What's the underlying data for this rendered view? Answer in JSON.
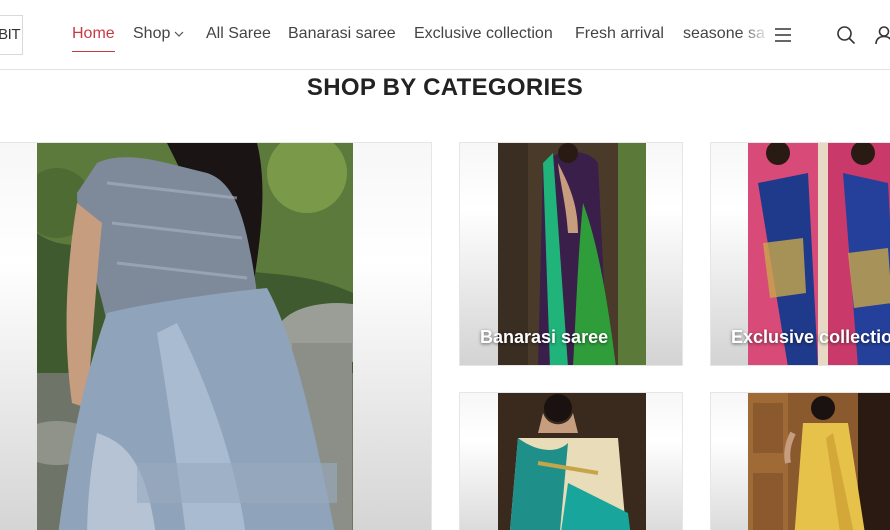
{
  "brand": {
    "logo_text": "EBIT"
  },
  "nav": {
    "items": [
      {
        "label": "Home",
        "active": true
      },
      {
        "label": "Shop",
        "has_dropdown": true
      },
      {
        "label": "All Saree"
      },
      {
        "label": "Banarasi saree"
      },
      {
        "label": "Exclusive collection"
      },
      {
        "label": "Fresh arrival"
      },
      {
        "label": "seasone sa"
      }
    ],
    "accent_color": "#c73a45"
  },
  "header_icons": [
    "menu-icon",
    "search-icon",
    "user-icon"
  ],
  "section": {
    "title": "SHOP BY CATEGORIES"
  },
  "categories": [
    {
      "label": ""
    },
    {
      "label": "Banarasi saree"
    },
    {
      "label": "Exclusive collection"
    },
    {
      "label": ""
    },
    {
      "label": ""
    }
  ]
}
